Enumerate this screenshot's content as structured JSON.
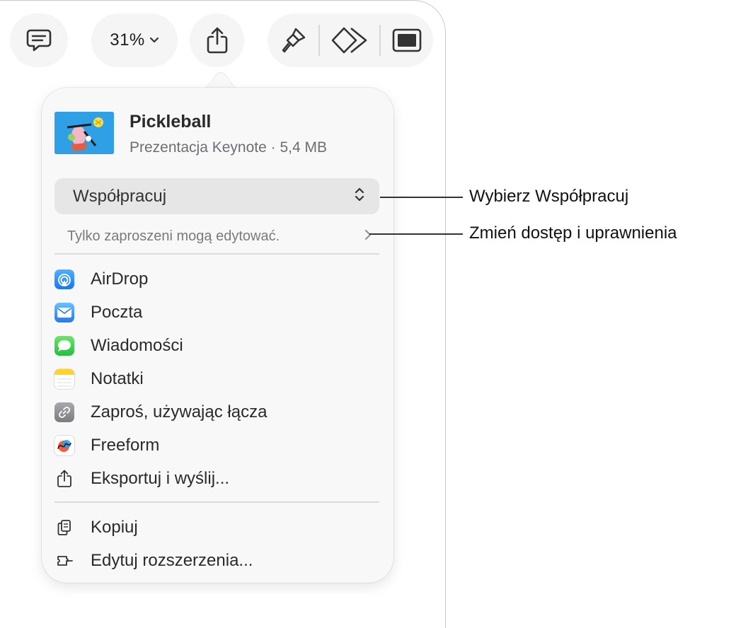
{
  "toolbar": {
    "zoom_value": "31%"
  },
  "document": {
    "title": "Pickleball",
    "subtitle": "Prezentacja Keynote · 5,4 MB"
  },
  "collaboration": {
    "selected": "Współpracuj",
    "access_text": "Tylko zaproszeni mogą edytować."
  },
  "share_menu": [
    {
      "label": "AirDrop",
      "icon": "airdrop-icon",
      "color": "#1e88f5"
    },
    {
      "label": "Poczta",
      "icon": "mail-icon",
      "color": "#2f8cf7"
    },
    {
      "label": "Wiadomości",
      "icon": "messages-icon",
      "color": "#34c759"
    },
    {
      "label": "Notatki",
      "icon": "notes-icon",
      "color": "#ffd426"
    },
    {
      "label": "Zaproś, używając łącza",
      "icon": "link-icon",
      "color": "#8e8e93"
    },
    {
      "label": "Freeform",
      "icon": "freeform-icon",
      "color": "#2a9df4"
    },
    {
      "label": "Eksportuj i wyślij...",
      "icon": "export-icon",
      "color": "#333333"
    }
  ],
  "extra_menu": [
    {
      "label": "Kopiuj",
      "icon": "copy-icon"
    },
    {
      "label": "Edytuj rozszerzenia...",
      "icon": "extensions-icon"
    }
  ],
  "callouts": {
    "collaborate": "Wybierz Współpracuj",
    "access": "Zmień dostęp i uprawnienia"
  }
}
